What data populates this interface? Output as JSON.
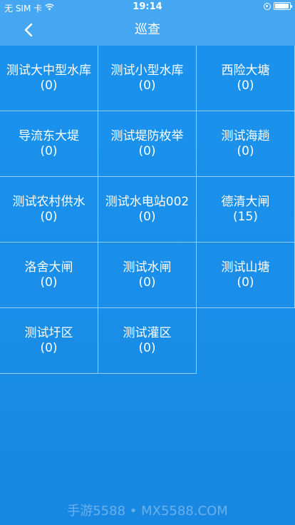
{
  "status_bar": {
    "carrier": "无 SIM 卡",
    "time": "19:14",
    "battery_level": 0.95
  },
  "nav": {
    "title": "巡查"
  },
  "grid": {
    "items": [
      {
        "name": "测试大中型水库",
        "count": "(0)"
      },
      {
        "name": "测试小型水库",
        "count": "(0)"
      },
      {
        "name": "西险大塘",
        "count": "(0)"
      },
      {
        "name": "导流东大堤",
        "count": "(0)"
      },
      {
        "name": "测试堤防枚举",
        "count": "(0)"
      },
      {
        "name": "测试海趟",
        "count": "(0)"
      },
      {
        "name": "测试农村供水",
        "count": "(0)"
      },
      {
        "name": "测试水电站002",
        "count": "(0)"
      },
      {
        "name": "德清大闸",
        "count": "(15)"
      },
      {
        "name": "洛舍大闸",
        "count": "(0)"
      },
      {
        "name": "测试水闸",
        "count": "(0)"
      },
      {
        "name": "测试山塘",
        "count": "(0)"
      },
      {
        "name": "测试圩区",
        "count": "(0)"
      },
      {
        "name": "测试灌区",
        "count": "(0)"
      }
    ]
  },
  "watermark": "手游5588 • MX5588.COM",
  "colors": {
    "background": "#1a8fe9",
    "nav_background": "#45a6f2",
    "text": "#ffffff"
  }
}
